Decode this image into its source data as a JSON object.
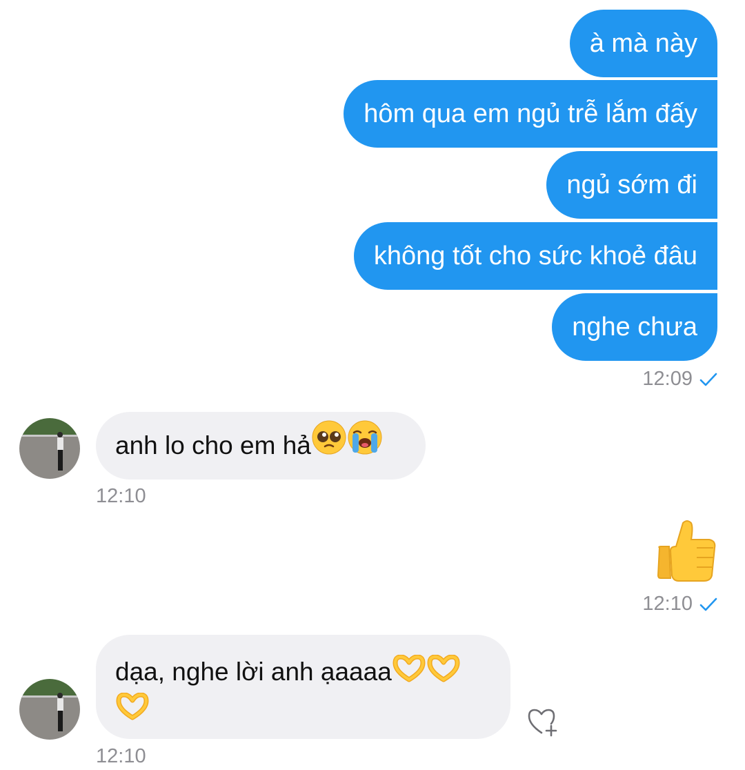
{
  "messages_outgoing_1": [
    {
      "text": "à mà này"
    },
    {
      "text": "hôm qua em ngủ trễ lắm đấy"
    },
    {
      "text": "ngủ sớm đi"
    },
    {
      "text": "không tốt cho sức khoẻ đâu"
    },
    {
      "text": "nghe chưa"
    }
  ],
  "time_out_1": "12:09",
  "incoming_1": {
    "text": "anh lo cho em hả",
    "emojis": [
      "pleading-face-emoji",
      "loudly-crying-face-emoji"
    ],
    "time": "12:10"
  },
  "outgoing_2": {
    "emoji": "thumbs-up-emoji",
    "time": "12:10"
  },
  "incoming_2": {
    "text": "dạa, nghe lời anh ạaaaa",
    "emojis": [
      "heart-hands-emoji",
      "heart-hands-emoji",
      "heart-hands-emoji"
    ],
    "time": "12:10"
  },
  "icons": {
    "read_receipt": "check-icon",
    "reaction": "heart-plus-icon"
  },
  "colors": {
    "outgoing_bubble": "#2196F0",
    "incoming_bubble": "#F0F0F3",
    "timestamp": "#8E8E93",
    "check": "#2196F0"
  }
}
